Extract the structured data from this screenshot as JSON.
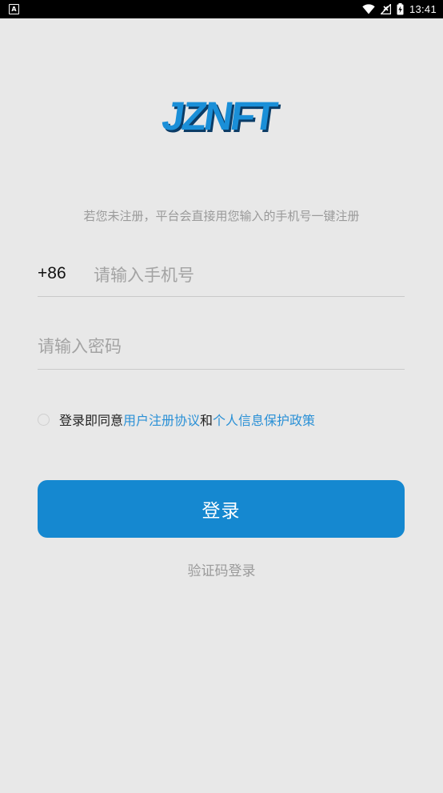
{
  "status_bar": {
    "left_icon": "A",
    "time": "13:41",
    "icons": [
      "wifi-icon",
      "signal-icon",
      "battery-charging-icon"
    ]
  },
  "logo": {
    "text": "JZNFT",
    "color": "#1a8fd8",
    "shadow": "#0b3c66"
  },
  "hint": "若您未注册，平台会直接用您输入的手机号一键注册",
  "phone": {
    "country_code": "+86",
    "placeholder": "请输入手机号",
    "value": ""
  },
  "password": {
    "placeholder": "请输入密码",
    "value": ""
  },
  "agreement": {
    "checked": false,
    "prefix": "登录即同意",
    "link1": "用户注册协议",
    "middle": "和",
    "link2": "个人信息保护政策"
  },
  "login_button": "登录",
  "sms_login": "验证码登录",
  "colors": {
    "accent": "#1588d0",
    "link": "#2a90d6",
    "background": "#e8e8e8"
  }
}
